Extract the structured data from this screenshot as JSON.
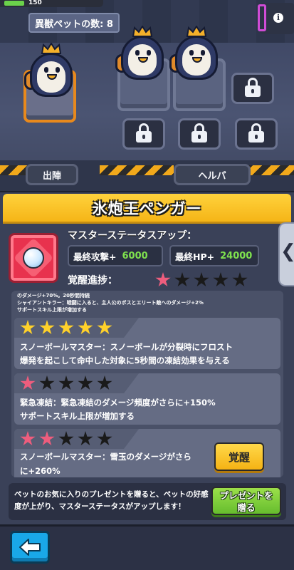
{
  "header": {
    "player_value": "150",
    "pet_count_label": "異獣ペットの数: 8",
    "info_icon_glyph": "i"
  },
  "scene": {
    "tabs": [
      "出陣",
      "ヘルパ"
    ],
    "locked_slots": 4
  },
  "pet": {
    "name": "氷炮王ペンガー",
    "icon": "snowball-icon"
  },
  "master_status": {
    "title": "マスターステータスアップ：",
    "stats": [
      {
        "label": "最終攻撃+",
        "value": "6000"
      },
      {
        "label": "最終HP+",
        "value": "24000"
      }
    ],
    "progress_label": "覚醒進捗：",
    "progress_stars": 1,
    "progress_max": 5
  },
  "skills": {
    "partial_lines": [
      "のダメージ+70%。20秒間持続",
      "シャイアントキラー：戦闘に入ると、主人公のボスとエリート敵へのダメージ+2%",
      "サポートスキル上限が増加する"
    ],
    "items": [
      {
        "stars": 5,
        "star_color": "gold",
        "lines": [
          "スノーボールマスター：スノーボールが分裂時にフロスト",
          "爆発を起こして命中した対象に5秒間の凍結効果を与える"
        ]
      },
      {
        "stars": 1,
        "star_color": "pink",
        "lines": [
          "緊急凍結：緊急凍結のダメージ頻度がさらに+150%",
          "サポートスキル上限が増加する"
        ]
      },
      {
        "stars": 2,
        "star_color": "pink",
        "lines": [
          "スノーボールマスター：雪玉のダメージがさら",
          "に+260%"
        ]
      }
    ],
    "awaken_button": "覚醒"
  },
  "footer": {
    "hint": "ペットのお気に入りのプレゼントを贈ると、ペットの好感度が上がり、マスターステータスがアップします！",
    "gift_button_line1": "プレゼントを",
    "gift_button_line2": "贈る"
  },
  "side_tab_glyph": "❮",
  "colors": {
    "title_bar": "#f5b517",
    "stat_value": "#7fe24e",
    "star_gold": "#ffd12a",
    "star_pink": "#ee5d7d",
    "awaken_button": "#ffd94a",
    "gift_button": "#66bd2e",
    "back_button": "#19a8e8"
  }
}
